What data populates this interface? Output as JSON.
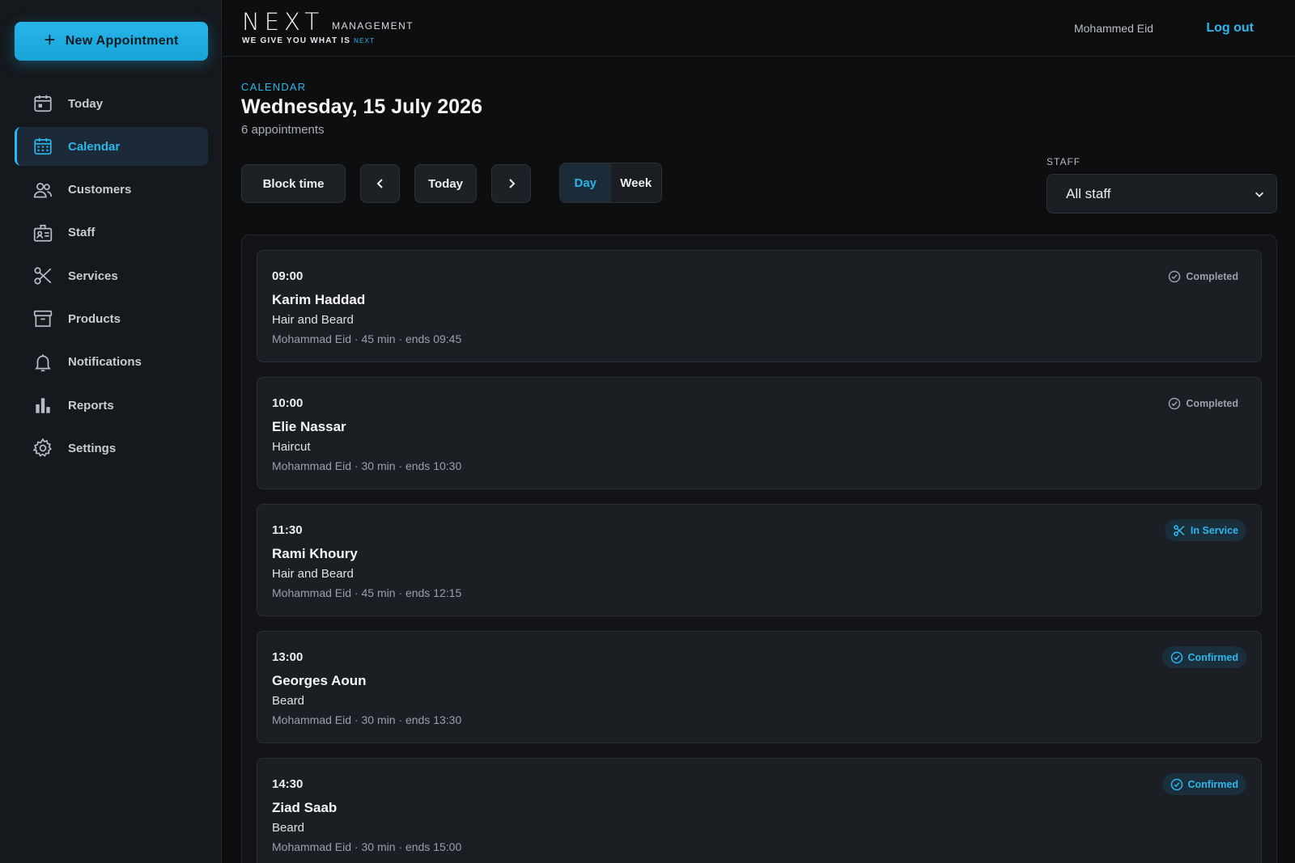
{
  "sidebar": {
    "new_appointment_label": "New Appointment",
    "items": [
      {
        "label": "Today",
        "icon": "calendar-day-icon"
      },
      {
        "label": "Calendar",
        "icon": "calendar-grid-icon",
        "active": true
      },
      {
        "label": "Customers",
        "icon": "users-icon"
      },
      {
        "label": "Staff",
        "icon": "staff-badge-icon"
      },
      {
        "label": "Services",
        "icon": "scissors-icon"
      },
      {
        "label": "Products",
        "icon": "archive-box-icon"
      },
      {
        "label": "Notifications",
        "icon": "bell-icon"
      },
      {
        "label": "Reports",
        "icon": "bar-chart-icon"
      },
      {
        "label": "Settings",
        "icon": "gear-icon"
      }
    ]
  },
  "topbar": {
    "logo_word": "NEXT",
    "logo_sub": "MANAGEMENT",
    "logo_tagline": "WE GIVE YOU WHAT IS",
    "logo_tagline_accent": "NEXT",
    "user_name": "Mohammed Eid",
    "logout_label": "Log out"
  },
  "header": {
    "breadcrumb": "CALENDAR",
    "title": "Wednesday, 15 July 2026",
    "count": "6 appointments"
  },
  "toolbar": {
    "block_time_label": "Block time",
    "today_label": "Today",
    "view_day_label": "Day",
    "view_week_label": "Week",
    "active_view": "Day",
    "staff_label": "STAFF",
    "staff_value": "All staff"
  },
  "appointments": [
    {
      "time": "09:00",
      "customer": "Karim Haddad",
      "service": "Hair and Beard",
      "meta": "Mohammad Eid · 45 min · ends 09:45",
      "status": "Completed",
      "status_kind": "completed"
    },
    {
      "time": "10:00",
      "customer": "Elie Nassar",
      "service": "Haircut",
      "meta": "Mohammad Eid · 30 min · ends 10:30",
      "status": "Completed",
      "status_kind": "completed"
    },
    {
      "time": "11:30",
      "customer": "Rami Khoury",
      "service": "Hair and Beard",
      "meta": "Mohammad Eid · 45 min · ends 12:15",
      "status": "In Service",
      "status_kind": "inservice"
    },
    {
      "time": "13:00",
      "customer": "Georges Aoun",
      "service": "Beard",
      "meta": "Mohammad Eid · 30 min · ends 13:30",
      "status": "Confirmed",
      "status_kind": "confirmed"
    },
    {
      "time": "14:30",
      "customer": "Ziad Saab",
      "service": "Beard",
      "meta": "Mohammad Eid · 30 min · ends 15:00",
      "status": "Confirmed",
      "status_kind": "confirmed"
    }
  ],
  "colors": {
    "accent": "#2cb7ec",
    "background": "#0d0e10",
    "sidebar": "#15181c",
    "card": "#1b1e23"
  }
}
